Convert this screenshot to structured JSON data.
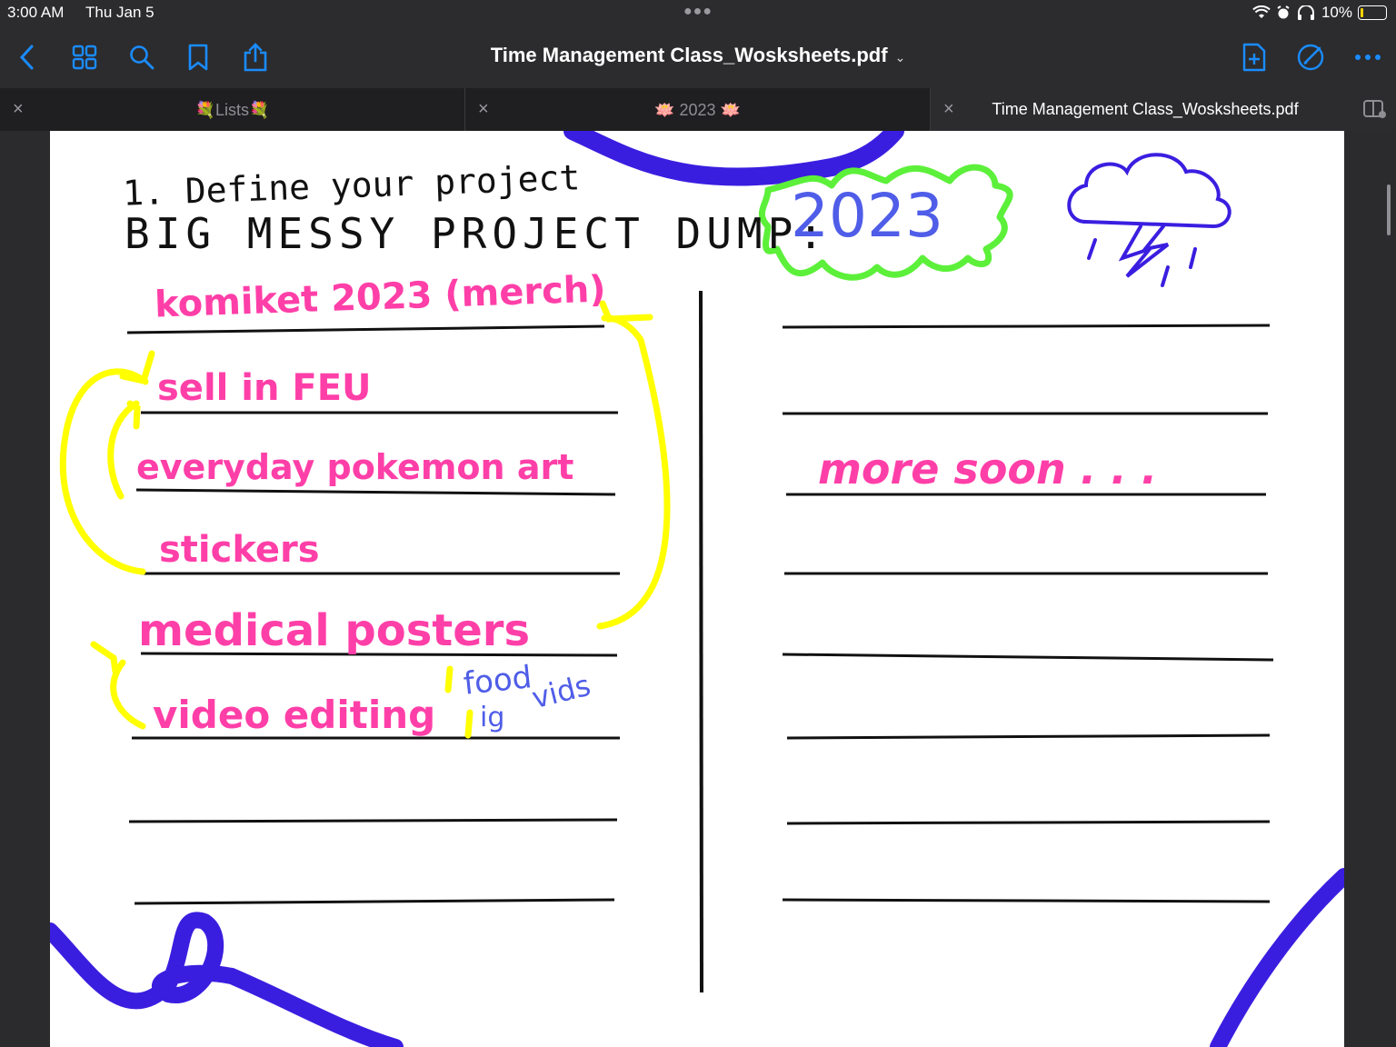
{
  "status_bar": {
    "time": "3:00 AM",
    "date": "Thu Jan 5",
    "battery": "10%"
  },
  "toolbar": {
    "document_title": "Time Management Class_Wosksheets.pdf"
  },
  "tabs": [
    {
      "label": "💐Lists💐"
    },
    {
      "label": "🪷 2023 🪷"
    },
    {
      "label": "Time Management Class_Wosksheets.pdf"
    }
  ],
  "worksheet": {
    "heading": "1. Define your project",
    "subheading": "BIG MESSY PROJECT DUMP:",
    "year_badge": "2023",
    "left_items": [
      "komiket 2023 (merch)",
      "sell in FEU",
      "everyday pokemon art",
      "stickers",
      "medical posters",
      "video editing"
    ],
    "side_notes": [
      "food",
      "ig",
      "vids"
    ],
    "right_note": "more soon . . ."
  },
  "colors": {
    "pink_ink": "#ff3fa8",
    "yellow_ink": "#ffff00",
    "blue_ink": "#4f5de8",
    "green_ink": "#5cf03a",
    "purple_ink": "#3a1ee0",
    "accent": "#1a8cff"
  }
}
